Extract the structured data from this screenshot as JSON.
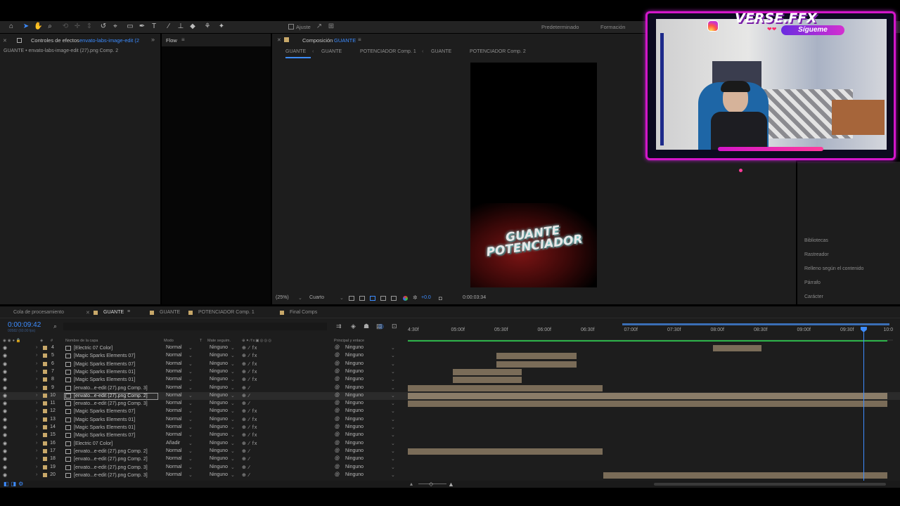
{
  "toolbar": {
    "ajuste": "Ajuste",
    "workspace1": "Predeterminado",
    "workspace2": "Formación"
  },
  "effects_panel": {
    "title_prefix": "Controles de efectos",
    "title_target": "envato-labs-image-edit (2",
    "subtitle": "GUANTE • envato-labs-image-edit (27).png Comp. 2"
  },
  "flow_panel": {
    "title": "Flow"
  },
  "comp_panel": {
    "title_prefix": "Composición",
    "title_target": "GUANTE",
    "breadcrumbs": [
      "GUANTE",
      "GUANTE",
      "POTENCIADOR Comp. 1",
      "GUANTE",
      "POTENCIADOR Comp. 2"
    ],
    "zoom": "(25%)",
    "resolution": "Cuarto",
    "exposure": "+0.0",
    "timecode": "0:00:03:34",
    "preview_text": "GUANTE POTENCIADOR"
  },
  "stream_overlay": {
    "brand": "VERSE.FFX",
    "follow": "Sígueme"
  },
  "right_panels": [
    "Bibliotecas",
    "Rastreador",
    "Relleno según el contenido",
    "Párrafo",
    "Carácter"
  ],
  "timeline": {
    "tabs": [
      "Cola de procesamiento",
      "GUANTE",
      "GUANTE",
      "POTENCIADOR Comp. 1",
      "Final Comps"
    ],
    "current_time": "0:00:09:42",
    "sub_time": "00582 (60.00 fps)",
    "col_headers": {
      "name": "Nombre de la capa",
      "mode": "Modo",
      "t": "T",
      "mate": "Mate seguim.",
      "parent": "Principal y enlace"
    },
    "ruler": [
      "4:30f",
      "05:00f",
      "05:30f",
      "06:00f",
      "06:30f",
      "07:00f",
      "07:30f",
      "08:00f",
      "08:30f",
      "09:00f",
      "09:30f",
      "10:0"
    ],
    "playhead_fraction": 0.95,
    "layers": [
      {
        "num": "4",
        "name": "[Electric 07 Color]",
        "mode": "Normal",
        "mate": "Ninguno",
        "parent": "Ninguno",
        "sw": "⊕ ∕ fx"
      },
      {
        "num": "5",
        "name": "[Magic Sparks Elements 07]",
        "mode": "Normal",
        "mate": "Ninguno",
        "parent": "Ninguno",
        "sw": "⊕ ∕ fx"
      },
      {
        "num": "6",
        "name": "[Magic Sparks Elements 07]",
        "mode": "Normal",
        "mate": "Ninguno",
        "parent": "Ninguno",
        "sw": "⊕ ∕ fx"
      },
      {
        "num": "7",
        "name": "[Magic Sparks Elements 01]",
        "mode": "Normal",
        "mate": "Ninguno",
        "parent": "Ninguno",
        "sw": "⊕ ∕ fx"
      },
      {
        "num": "8",
        "name": "[Magic Sparks Elements 01]",
        "mode": "Normal",
        "mate": "Ninguno",
        "parent": "Ninguno",
        "sw": "⊕ ∕ fx"
      },
      {
        "num": "9",
        "name": "[envato...e-edit (27).png Comp. 3]",
        "mode": "Normal",
        "mate": "Ninguno",
        "parent": "Ninguno",
        "sw": "⊕ ∕"
      },
      {
        "num": "10",
        "name": "[envato...e-edit (27).png Comp. 2]",
        "mode": "Normal",
        "mate": "Ninguno",
        "parent": "Ninguno",
        "sw": "⊕ ∕"
      },
      {
        "num": "11",
        "name": "[envato...e-edit (27).png Comp. 3]",
        "mode": "Normal",
        "mate": "Ninguno",
        "parent": "Ninguno",
        "sw": "⊕ ∕"
      },
      {
        "num": "12",
        "name": "[Magic Sparks Elements 07]",
        "mode": "Normal",
        "mate": "Ninguno",
        "parent": "Ninguno",
        "sw": "⊕ ∕ fx"
      },
      {
        "num": "13",
        "name": "[Magic Sparks Elements 01]",
        "mode": "Normal",
        "mate": "Ninguno",
        "parent": "Ninguno",
        "sw": "⊕ ∕ fx"
      },
      {
        "num": "14",
        "name": "[Magic Sparks Elements 01]",
        "mode": "Normal",
        "mate": "Ninguno",
        "parent": "Ninguno",
        "sw": "⊕ ∕ fx"
      },
      {
        "num": "15",
        "name": "[Magic Sparks Elements 07]",
        "mode": "Normal",
        "mate": "Ninguno",
        "parent": "Ninguno",
        "sw": "⊕ ∕ fx"
      },
      {
        "num": "16",
        "name": "[Electric 07 Color]",
        "mode": "Añadir",
        "mate": "Ninguno",
        "parent": "Ninguno",
        "sw": "⊕ ∕ fx"
      },
      {
        "num": "17",
        "name": "[envato...e-edit (27).png Comp. 2]",
        "mode": "Normal",
        "mate": "Ninguno",
        "parent": "Ninguno",
        "sw": "⊕ ∕"
      },
      {
        "num": "18",
        "name": "[envato...e-edit (27).png Comp. 2]",
        "mode": "Normal",
        "mate": "Ninguno",
        "parent": "Ninguno",
        "sw": "⊕ ∕"
      },
      {
        "num": "19",
        "name": "[envato...e-edit (27).png Comp. 3]",
        "mode": "Normal",
        "mate": "Ninguno",
        "parent": "Ninguno",
        "sw": "⊕ ∕"
      },
      {
        "num": "20",
        "name": "[envato...e-edit (27).png Comp. 3]",
        "mode": "Normal",
        "mate": "Ninguno",
        "parent": "Ninguno",
        "sw": "⊕ ∕"
      }
    ]
  }
}
